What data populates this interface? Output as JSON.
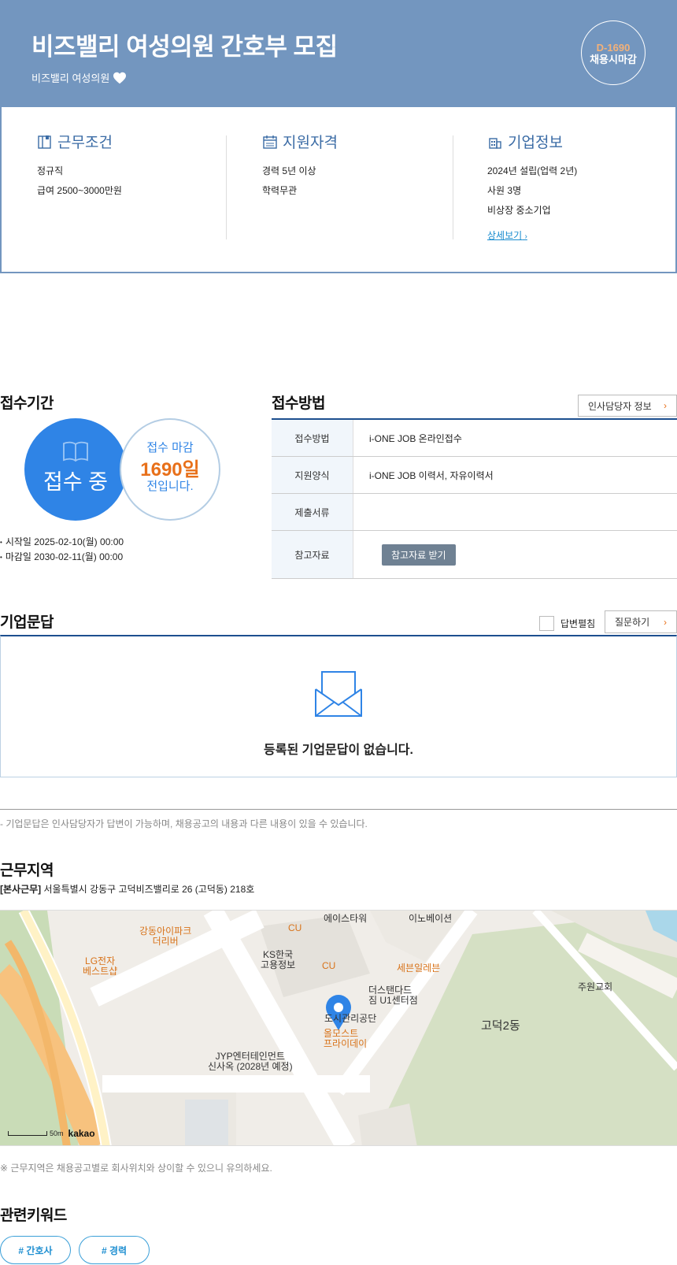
{
  "header": {
    "title": "비즈밸리 여성의원 간호부 모집",
    "company": "비즈밸리 여성의원",
    "dday": "D-1690",
    "deadline_type": "채용시마감"
  },
  "summary": {
    "work": {
      "title": "근무조건",
      "items": [
        "정규직",
        "급여 2500~3000만원"
      ]
    },
    "qualification": {
      "title": "지원자격",
      "items": [
        "경력 5년 이상",
        "학력무관"
      ]
    },
    "company": {
      "title": "기업정보",
      "items": [
        "2024년 설립(업력 2년)",
        "사원 3명",
        "비상장 중소기업"
      ],
      "detail_link": "상세보기"
    }
  },
  "reception": {
    "title": "접수기간",
    "status": "접수 중",
    "remain_label": "접수 마감",
    "remain_days": "1690일",
    "remain_suffix": "전입니다.",
    "start": "시작일 2025-02-10(월) 00:00",
    "end": "마감일 2030-02-11(월) 00:00"
  },
  "method": {
    "title": "접수방법",
    "hr_button": "인사담당자 정보",
    "rows": [
      {
        "label": "접수방법",
        "value": "i-ONE JOB 온라인접수"
      },
      {
        "label": "지원양식",
        "value": "i-ONE JOB 이력서, 자유이력서"
      },
      {
        "label": "제출서류",
        "value": ""
      },
      {
        "label": "참고자료",
        "button": "참고자료 받기"
      }
    ]
  },
  "qa": {
    "title": "기업문답",
    "expand_label": "답변펼침",
    "ask_button": "질문하기",
    "empty": "등록된 기업문답이 없습니다.",
    "note": "- 기업문답은 인사담당자가 답변이 가능하며, 채용공고의 내용과 다른 내용이 있을 수 있습니다."
  },
  "location": {
    "title": "근무지역",
    "tag": "[본사근무]",
    "address": "서울특별시 강동구 고덕비즈밸리로 26 (고덕동) 218호",
    "note": "※ 근무지역은 채용공고별로 회사위치와 상이할 수 있으니 유의하세요.",
    "map_labels": {
      "gangdong_ipark": "강동아이파크\n더리버",
      "lg": "LG전자\n베스트샵",
      "cu1": "CU",
      "cu2": "CU",
      "ks": "KS한국\n고용정보",
      "ace": "에이스타워",
      "inno": "이노베이션",
      "seven": "세븐일레븐",
      "theskin": "더스탠다드\n짐 U1센터점",
      "jubeon": "주원교회",
      "gongdan": "도시관리공단",
      "almost": "올모스트\n프라이데이",
      "gd2": "고덕2동",
      "jyp": "JYP엔터테인먼트\n신사옥 (2028년 예정)",
      "scale": "50m",
      "brand": "kakao"
    }
  },
  "keywords": {
    "title": "관련키워드",
    "items": [
      "# 간호사",
      "# 경력"
    ]
  }
}
